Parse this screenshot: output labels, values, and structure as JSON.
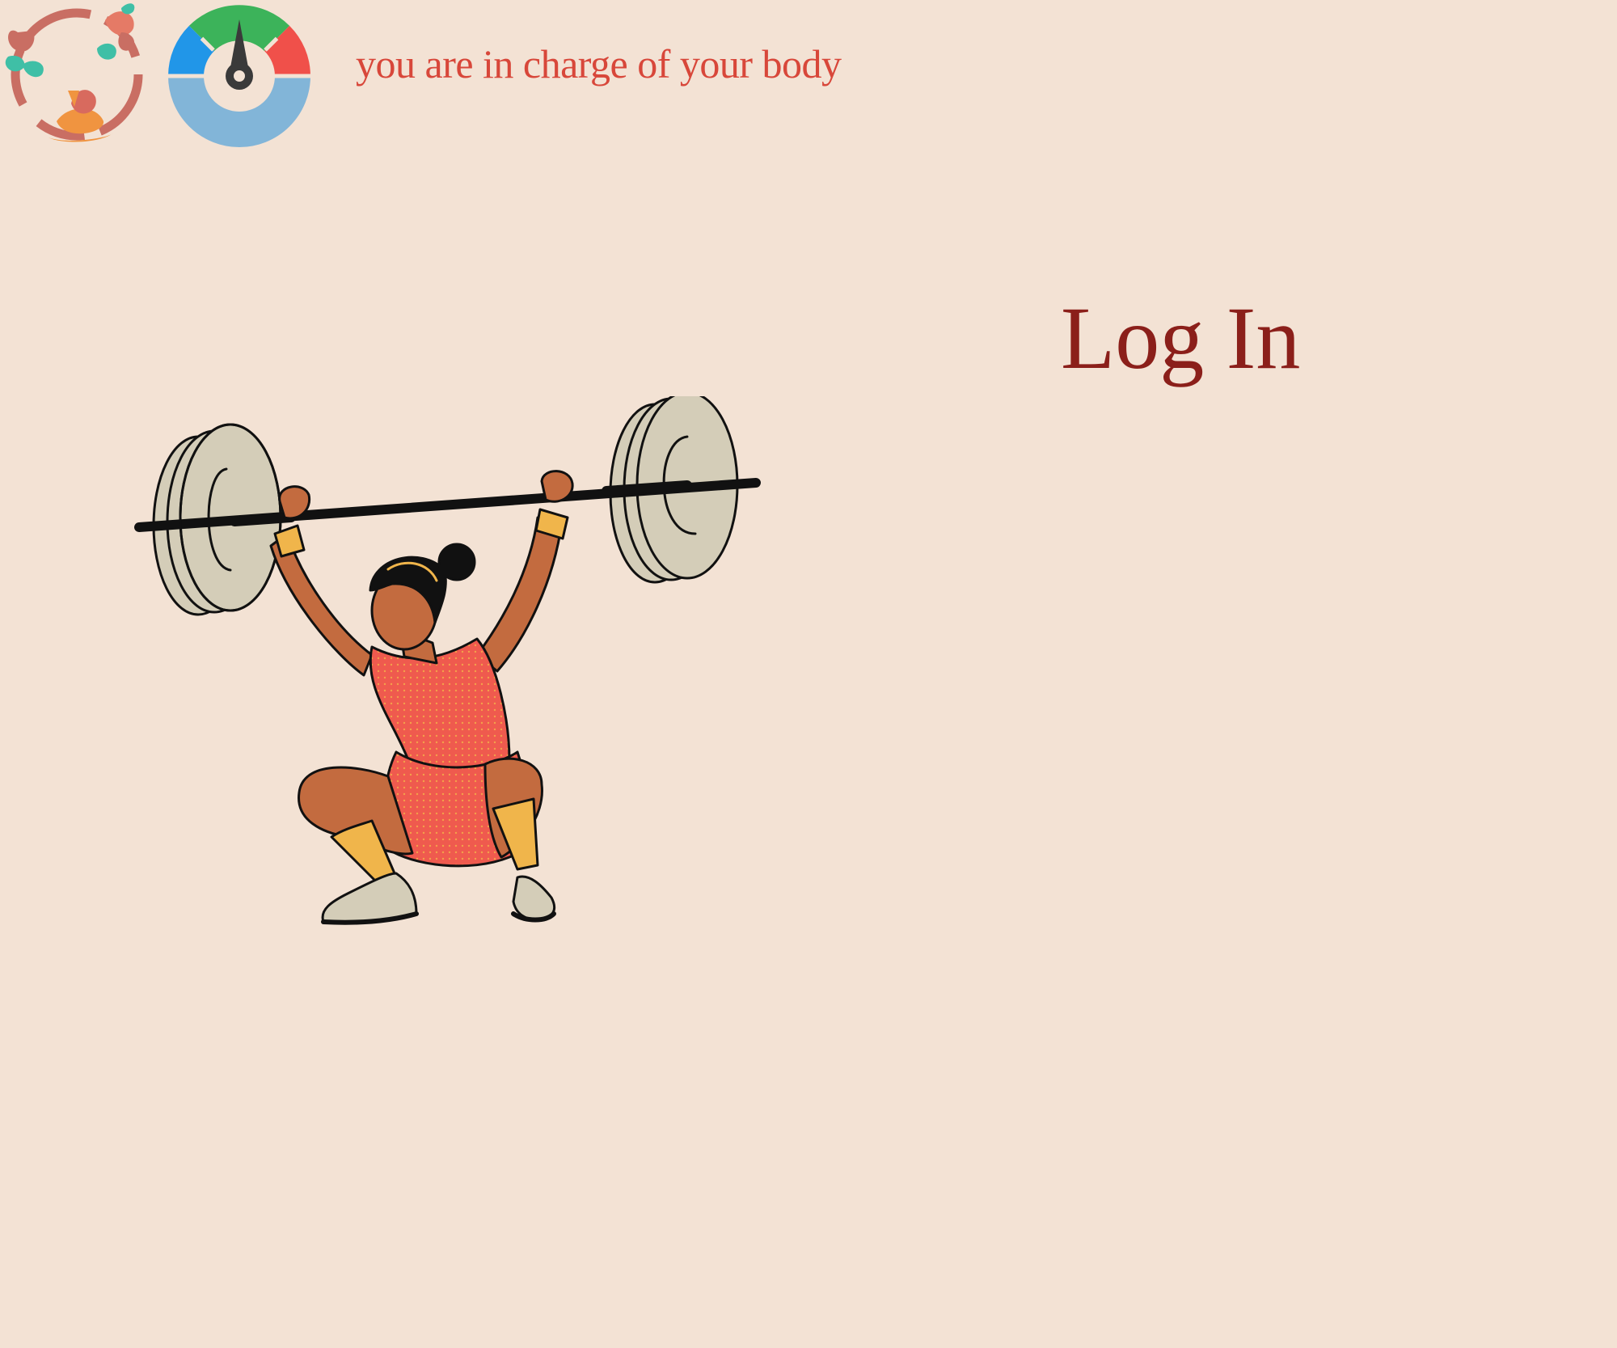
{
  "header": {
    "tagline": "you are in charge of your body"
  },
  "main": {
    "heading": "Log In"
  },
  "icons": {
    "brand_logo": "floral-wreath-icon",
    "body_gauge": "gauge-meter-icon",
    "hero_illustration": "weightlifter-illustration"
  },
  "colors": {
    "background": "#f3e2d4",
    "tagline": "#d8473a",
    "heading": "#8b1f1a",
    "gauge_green": "#3cb35a",
    "gauge_blue": "#2196e8",
    "gauge_red": "#f0504a",
    "gauge_lightblue": "#82b5d8",
    "needle": "#3a3a3a",
    "outfit": "#ef5a4e",
    "skin": "#c36b3f",
    "sock": "#f0b54b",
    "plate": "#d4cdb8"
  }
}
